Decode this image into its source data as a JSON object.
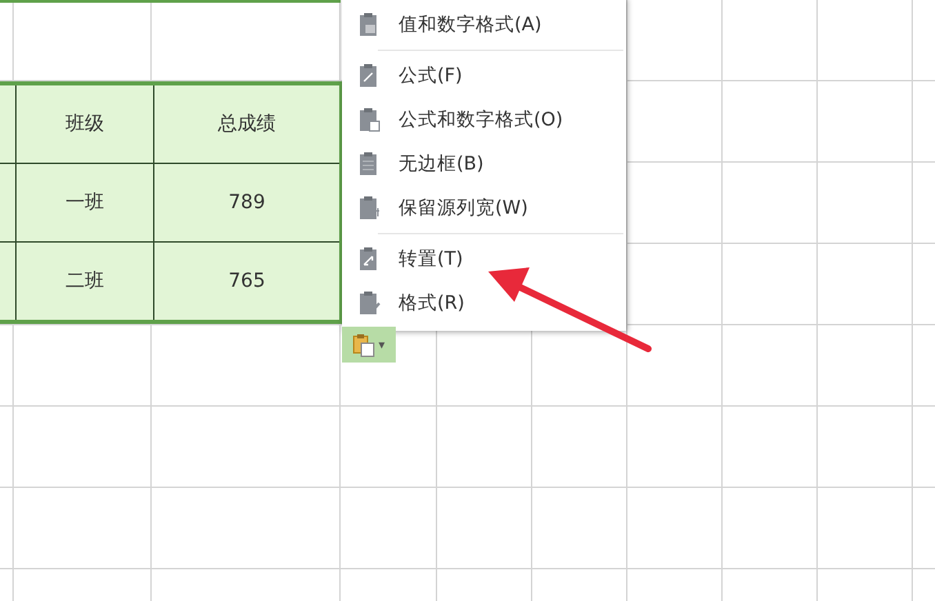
{
  "table": {
    "columns": [
      "班级",
      "总成绩"
    ],
    "rows": [
      [
        "一班",
        "789"
      ],
      [
        "二班",
        "765"
      ]
    ]
  },
  "paste_menu": {
    "groups": [
      [
        {
          "label": "值和数字格式(A)"
        }
      ],
      [
        {
          "label": "公式(F)"
        },
        {
          "label": "公式和数字格式(O)"
        },
        {
          "label": "无边框(B)"
        },
        {
          "label": "保留源列宽(W)"
        }
      ],
      [
        {
          "label": "转置(T)"
        },
        {
          "label": "格式(R)"
        }
      ]
    ]
  },
  "paste_button": {
    "caret": "▾"
  }
}
